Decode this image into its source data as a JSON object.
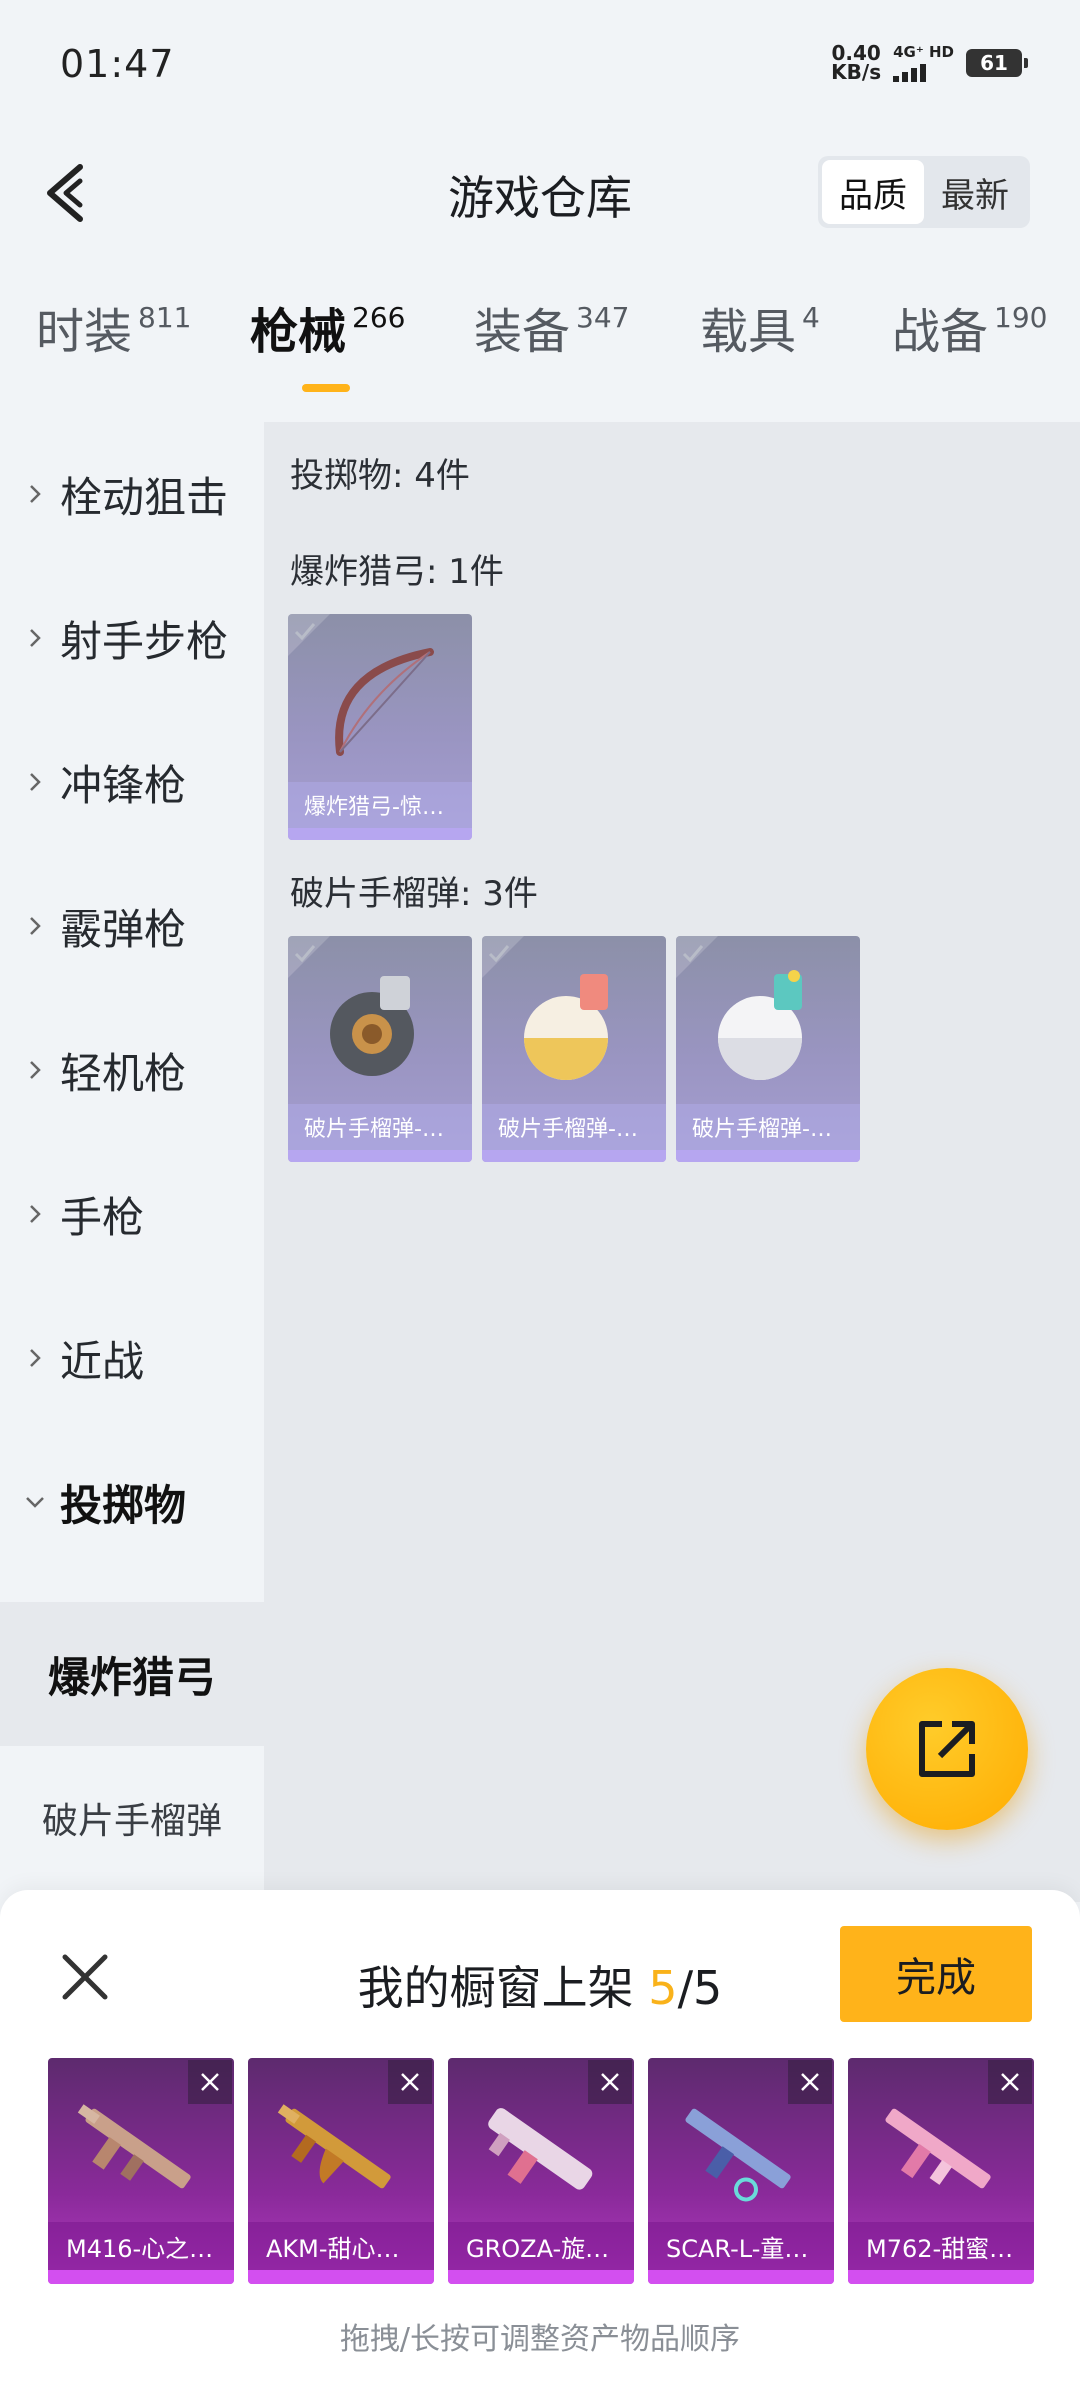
{
  "status": {
    "time": "01:47",
    "speed_value": "0.40",
    "speed_unit": "KB/s",
    "network": "4G⁺ HD",
    "battery": "61"
  },
  "header": {
    "title": "游戏仓库",
    "sort_options": [
      "品质",
      "最新"
    ],
    "sort_selected": "品质"
  },
  "categories": [
    {
      "label": "时装",
      "count": "811"
    },
    {
      "label": "枪械",
      "count": "266",
      "active": true
    },
    {
      "label": "装备",
      "count": "347"
    },
    {
      "label": "载具",
      "count": "4"
    },
    {
      "label": "战备",
      "count": "190"
    }
  ],
  "sidebar": {
    "items": [
      "栓动狙击",
      "射手步枪",
      "冲锋枪",
      "霰弹枪",
      "轻机枪",
      "手枪",
      "近战",
      "投掷物"
    ],
    "sub_items": [
      "爆炸猎弓",
      "破片手榴弹"
    ],
    "selected_sub": "爆炸猎弓"
  },
  "content": {
    "summary": "投掷物: 4件",
    "groups": [
      {
        "title": "爆炸猎弓: 1件",
        "items": [
          {
            "name": "爆炸猎弓-惊…",
            "icon": "bow-icon"
          }
        ]
      },
      {
        "title": "破片手榴弹: 3件",
        "items": [
          {
            "name": "破片手榴弹-…",
            "icon": "grenade-icon"
          },
          {
            "name": "破片手榴弹-…",
            "icon": "grenade-icon"
          },
          {
            "name": "破片手榴弹-…",
            "icon": "grenade-icon"
          }
        ]
      }
    ]
  },
  "sheet": {
    "title_prefix": "我的橱窗上架",
    "current": "5",
    "slash_total": "/5",
    "done_label": "完成",
    "weapons": [
      {
        "name": "M416-心之…",
        "icon": "rifle-icon"
      },
      {
        "name": "AKM-甜心…",
        "icon": "rifle-icon"
      },
      {
        "name": "GROZA-旋…",
        "icon": "rifle-icon"
      },
      {
        "name": "SCAR-L-童…",
        "icon": "rifle-icon"
      },
      {
        "name": "M762-甜蜜…",
        "icon": "rifle-icon"
      }
    ],
    "hint": "拖拽/长按可调整资产物品顺序"
  },
  "colors": {
    "accent": "#ffb31a",
    "background": "#f1f4f7",
    "panel": "#e6e9ed"
  }
}
